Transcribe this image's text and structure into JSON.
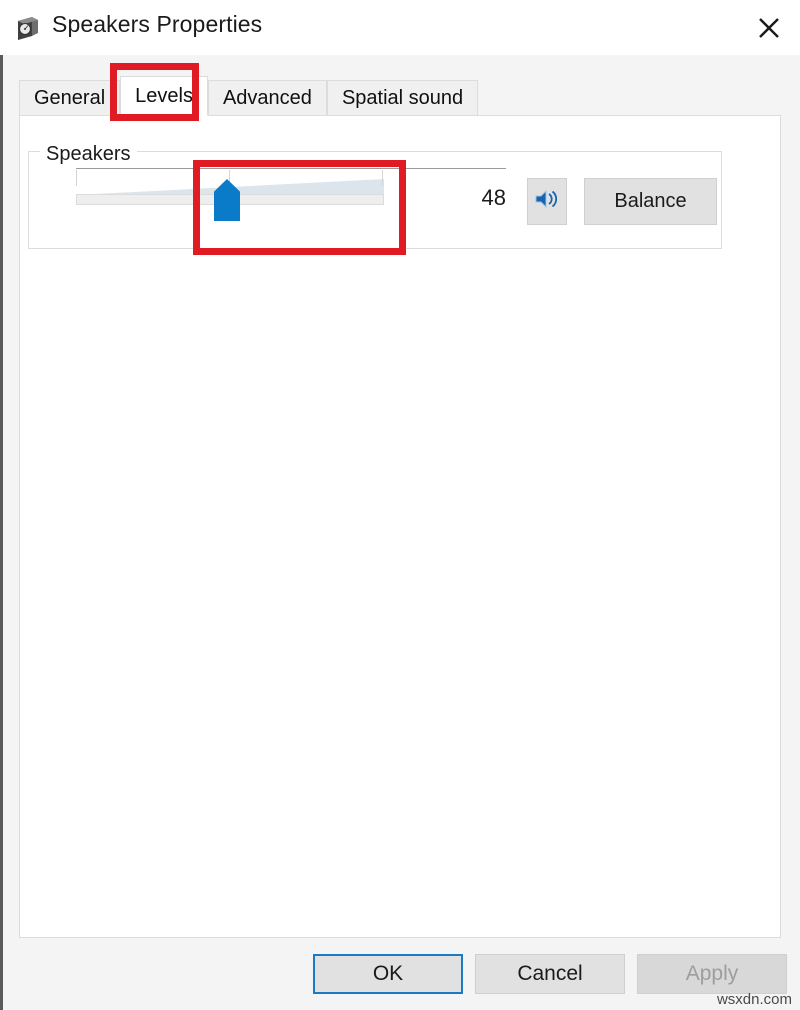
{
  "window": {
    "title": "Speakers Properties",
    "icon": "speaker-box-icon",
    "close_label": "✕"
  },
  "tabs": [
    {
      "label": "General",
      "selected": false
    },
    {
      "label": "Levels",
      "selected": true
    },
    {
      "label": "Advanced",
      "selected": false
    },
    {
      "label": "Spatial sound",
      "selected": false
    }
  ],
  "levels_panel": {
    "group_label": "Speakers",
    "volume_value": "48",
    "volume_min": 0,
    "volume_max": 100,
    "mute_icon": "speaker-volume-icon",
    "balance_label": "Balance"
  },
  "footer": {
    "ok_label": "OK",
    "cancel_label": "Cancel",
    "apply_label": "Apply"
  },
  "annotations": {
    "highlight_color": "#e01b24",
    "boxes": [
      "levels-tab",
      "volume-slider"
    ]
  },
  "watermark": "wsxdn.com"
}
